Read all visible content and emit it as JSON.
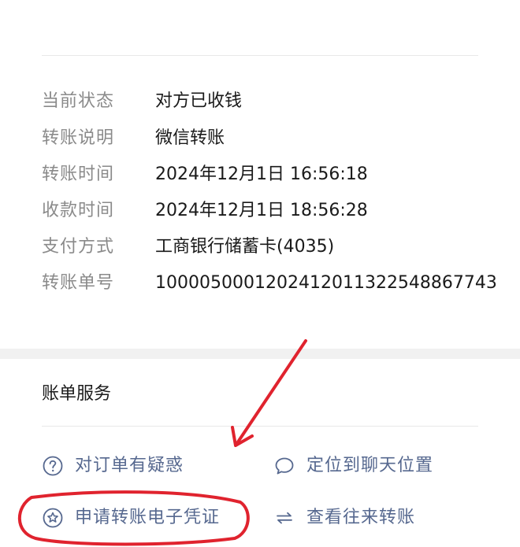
{
  "details": [
    {
      "label": "当前状态",
      "value": "对方已收钱"
    },
    {
      "label": "转账说明",
      "value": "微信转账"
    },
    {
      "label": "转账时间",
      "value": "2024年12月1日 16:56:18"
    },
    {
      "label": "收款时间",
      "value": "2024年12月1日 18:56:28"
    },
    {
      "label": "支付方式",
      "value": "工商银行储蓄卡(4035)"
    },
    {
      "label": "转账单号",
      "value": "1000050001202412011322548867743"
    }
  ],
  "bill_services": {
    "title": "账单服务",
    "items": [
      {
        "label": "对订单有疑惑",
        "icon": "question-circle-icon"
      },
      {
        "label": "定位到聊天位置",
        "icon": "chat-bubble-icon"
      },
      {
        "label": "申请转账电子凭证",
        "icon": "star-circle-icon"
      },
      {
        "label": "查看往来转账",
        "icon": "transfer-arrows-icon"
      }
    ]
  },
  "colors": {
    "label_gray": "#8a8a8a",
    "value_text": "#1a1a1a",
    "link_blue": "#56688f",
    "annotation_red": "#e0232e",
    "band_gray": "#f1f1f1"
  }
}
